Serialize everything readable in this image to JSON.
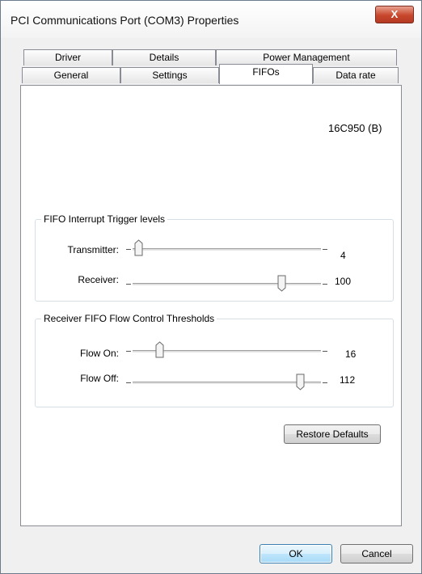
{
  "window": {
    "title": "PCI Communications Port (COM3) Properties",
    "close_label": "X"
  },
  "tabs": {
    "row_back": [
      "Driver",
      "Details",
      "Power Management"
    ],
    "row_front": [
      "General",
      "Settings",
      "FIFOs",
      "Data rate"
    ],
    "active": "FIFOs"
  },
  "fifo": {
    "chip": "16C950 (B)",
    "interrupt_group": {
      "legend": "FIFO Interrupt Trigger levels",
      "transmitter_label": "Transmitter:",
      "transmitter_value": "4",
      "transmitter_fraction": 0.03,
      "receiver_label": "Receiver:",
      "receiver_value": "100",
      "receiver_fraction": 0.79
    },
    "flow_group": {
      "legend": "Receiver FIFO Flow Control Thresholds",
      "flow_on_label": "Flow On:",
      "flow_on_value": "16",
      "flow_on_fraction": 0.14,
      "flow_off_label": "Flow Off:",
      "flow_off_value": "112",
      "flow_off_fraction": 0.89
    },
    "restore_label": "Restore Defaults"
  },
  "buttons": {
    "ok": "OK",
    "cancel": "Cancel"
  }
}
